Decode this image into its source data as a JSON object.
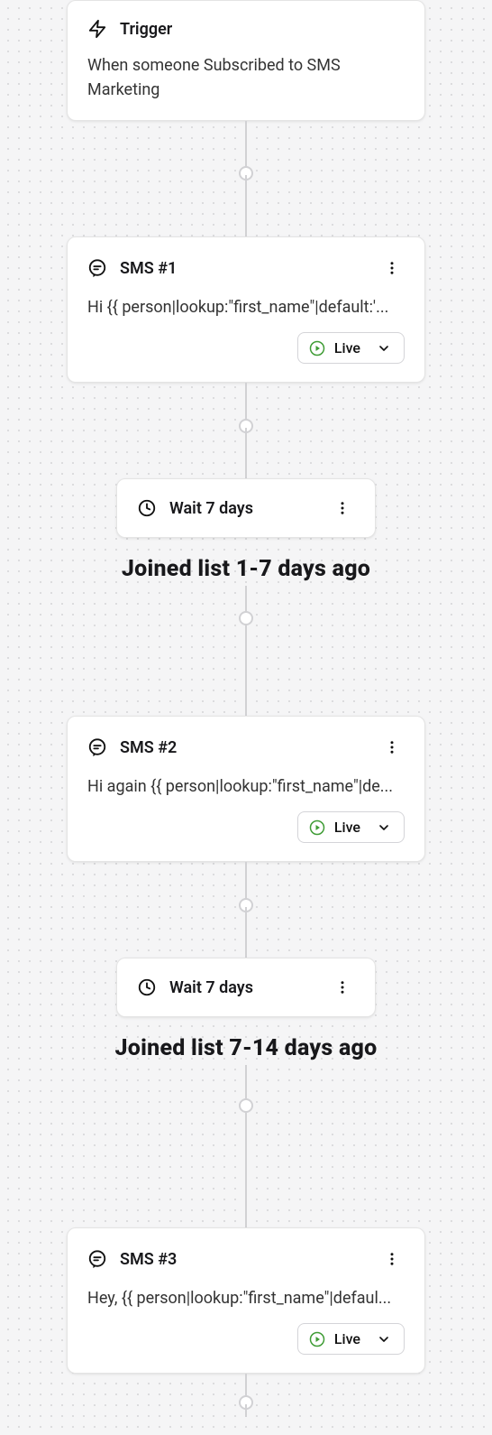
{
  "trigger": {
    "title": "Trigger",
    "description": "When someone Subscribed to SMS Marketing"
  },
  "sms1": {
    "title": "SMS #1",
    "preview": "Hi {{ person|lookup:\"first_name\"|default:'...",
    "status": "Live"
  },
  "wait1": {
    "label": "Wait 7 days"
  },
  "annotation1": "Joined list 1-7 days ago",
  "sms2": {
    "title": "SMS #2",
    "preview": "Hi again {{ person|lookup:\"first_name\"|de...",
    "status": "Live"
  },
  "wait2": {
    "label": "Wait 7 days"
  },
  "annotation2": "Joined list 7-14 days ago",
  "sms3": {
    "title": "SMS #3",
    "preview": "Hey, {{ person|lookup:\"first_name\"|defaul...",
    "status": "Live"
  }
}
